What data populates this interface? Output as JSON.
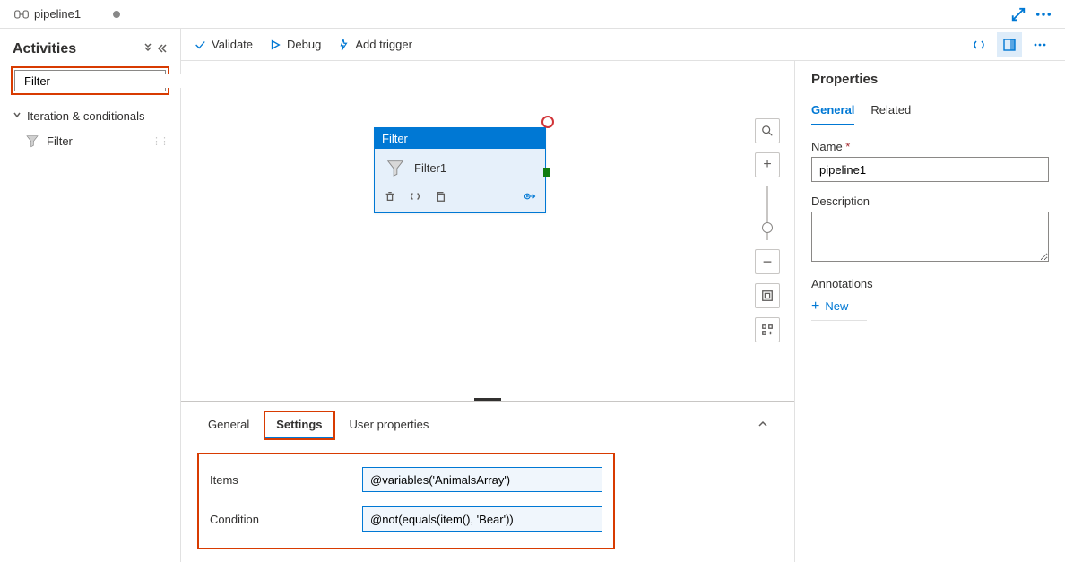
{
  "tab": {
    "title": "pipeline1"
  },
  "activities": {
    "title": "Activities",
    "search_value": "Filter",
    "category": "Iteration & conditionals",
    "item": "Filter"
  },
  "toolbar": {
    "validate": "Validate",
    "debug": "Debug",
    "add_trigger": "Add trigger"
  },
  "node": {
    "type": "Filter",
    "name": "Filter1"
  },
  "bottom": {
    "tabs": {
      "general": "General",
      "settings": "Settings",
      "user_props": "User properties"
    },
    "fields": {
      "items_label": "Items",
      "items_value": "@variables('AnimalsArray')",
      "condition_label": "Condition",
      "condition_value": "@not(equals(item(), 'Bear'))"
    }
  },
  "props": {
    "title": "Properties",
    "tabs": {
      "general": "General",
      "related": "Related"
    },
    "name_label": "Name",
    "name_value": "pipeline1",
    "desc_label": "Description",
    "desc_value": "",
    "annotations_label": "Annotations",
    "new_label": "New"
  }
}
